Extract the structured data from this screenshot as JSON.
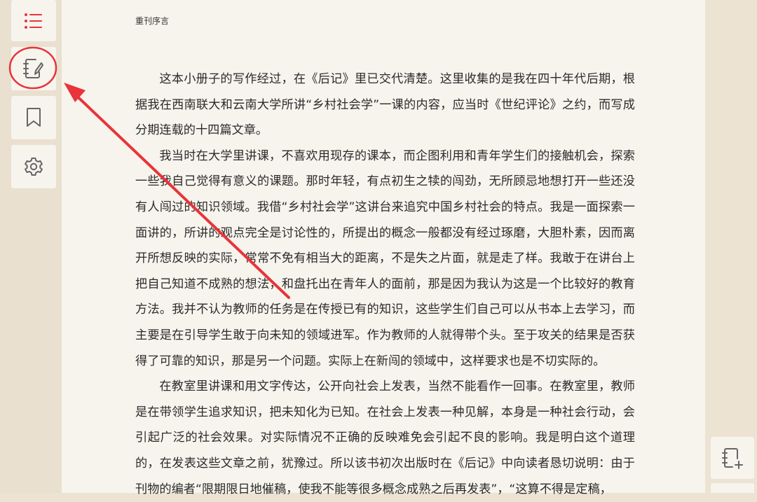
{
  "header": {
    "running_title": "重刊序言"
  },
  "toolbar": {
    "items": [
      {
        "id": "toc",
        "icon": "list-icon"
      },
      {
        "id": "notes",
        "icon": "notebook-pen-icon"
      },
      {
        "id": "bookmark",
        "icon": "bookmark-icon"
      },
      {
        "id": "settings",
        "icon": "gear-icon"
      }
    ],
    "accent_color": "#e8343a",
    "icon_color": "#666666"
  },
  "content": {
    "paragraphs": [
      "这本小册子的写作经过，在《后记》里已交代清楚。这里收集的是我在四十年代后期，根据我在西南联大和云南大学所讲“乡村社会学”一课的内容，应当时《世纪评论》之约，而写成分期连载的十四篇文章。",
      "我当时在大学里讲课，不喜欢用现存的课本，而企图利用和青年学生们的接触机会，探索一些我自己觉得有意义的课题。那时年轻，有点初生之犊的闯劲，无所顾忌地想打开一些还没有人闯过的知识领域。我借“乡村社会学”这讲台来追究中国乡村社会的特点。我是一面探索一面讲的，所讲的观点完全是讨论性的，所提出的概念一般都没有经过琢磨，大胆朴素，因而离开所想反映的实际，常常不免有相当大的距离，不是失之片面，就是走了样。我敢于在讲台上把自己知道不成熟的想法，和盘托出在青年人的面前，那是因为我认为这是一个比较好的教育方法。我并不认为教师的任务是在传授已有的知识，这些学生们自己可以从书本上去学习，而主要是在引导学生敢于向未知的领域进军。作为教师的人就得带个头。至于攻关的结果是否获得了可靠的知识，那是另一个问题。实际上在新闯的领域中，这样要求也是不切实际的。",
      "在教室里讲课和用文字传达，公开向社会上发表，当然不能看作一回事。在教室里，教师是在带领学生追求知识，把未知化为已知。在社会上发表一种见解，本身是一种社会行动，会引起广泛的社会效果。对实际情况不正确的反映难免会引起不良的影响。我是明白这个道理的，在发表这些文章之前，犹豫过。所以该书初次出版时在《后记》中向读者恳切说明：由于刊物的编者“限期限日地催稿，使我不能等很多概念成熟之后再发表”，“这算不得是定稿，"
    ]
  },
  "right_toolbar": {
    "add_note_icon": "note-add-icon"
  },
  "annotation": {
    "color": "#e8343a"
  }
}
